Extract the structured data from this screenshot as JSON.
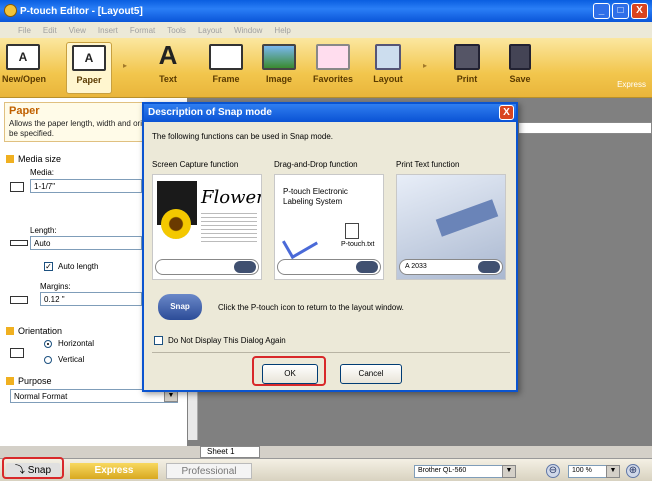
{
  "window": {
    "title": "P-touch Editor - [Layout5]",
    "minimize": "_",
    "maximize": "□",
    "close": "X"
  },
  "menu": [
    "File",
    "Edit",
    "View",
    "Insert",
    "Format",
    "Tools",
    "Layout",
    "Window",
    "Help"
  ],
  "ribbon": {
    "buttons": [
      "New/Open",
      "Paper",
      "Text",
      "Frame",
      "Image",
      "Favorites",
      "Layout",
      "Print",
      "Save"
    ],
    "express": "Express"
  },
  "left_panel": {
    "title": "Paper",
    "description": "Allows the paper length, width and orientation to be specified.",
    "media_size": "Media size",
    "media_label": "Media:",
    "media_value": "1-1/7\"",
    "length_label": "Length:",
    "length_value": "Auto",
    "auto_length": "Auto length",
    "margins_label": "Margins:",
    "margins_value": "0.12 \"",
    "orientation": "Orientation",
    "horizontal": "Horizontal",
    "vertical": "Vertical",
    "purpose": "Purpose",
    "purpose_value": "Normal Format"
  },
  "workspace": {
    "sheet_tab": "Sheet 1"
  },
  "statusbar": {
    "snap": "Snap",
    "express": "Express",
    "professional": "Professional",
    "printer": "Brother QL-560",
    "zoom": "100 %",
    "zoom_out": "⊖",
    "zoom_in": "⊕"
  },
  "dialog": {
    "title": "Description of Snap mode",
    "close": "X",
    "intro": "The following functions can be used in Snap mode.",
    "col1_title": "Screen Capture function",
    "col2_title": "Drag-and-Drop function",
    "col3_title": "Print Text function",
    "flower_word": "Flower",
    "dd_text": "P-touch Electronic Labeling System",
    "dd_file": "P-touch.txt",
    "print_value": "A 2033",
    "snap_text": "Click the P-touch icon to return to the layout window.",
    "snap_icon_label": "Snap",
    "checkbox_label": "Do Not Display This Dialog Again",
    "ok": "OK",
    "cancel": "Cancel"
  },
  "colors": {
    "titlebar": "#0a5ee0",
    "ribbon": "#f2c64d",
    "highlight": "#d8282a"
  }
}
